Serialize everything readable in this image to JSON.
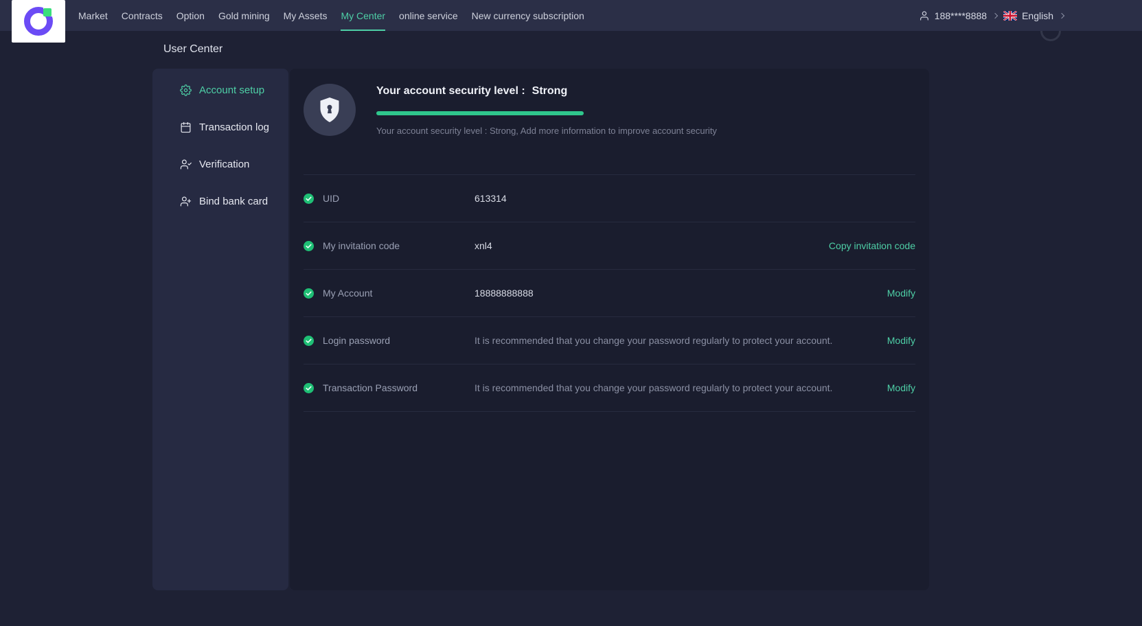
{
  "topbar": {
    "nav_items": [
      "Market",
      "Contracts",
      "Option",
      "Gold mining",
      "My Assets",
      "My Center",
      "online service",
      "New currency subscription"
    ],
    "active_item": "My Center",
    "account_label": "188****8888",
    "language_label": "English"
  },
  "page": {
    "title": "User Center"
  },
  "sidebar": {
    "items": [
      {
        "label": "Account setup",
        "icon": "gear-icon",
        "active": true
      },
      {
        "label": "Transaction log",
        "icon": "calendar-icon",
        "active": false
      },
      {
        "label": "Verification",
        "icon": "user-icon",
        "active": false
      },
      {
        "label": "Bind bank card",
        "icon": "user-icon",
        "active": false
      }
    ]
  },
  "security": {
    "title": "Your account security level :",
    "level": "Strong",
    "progress_percent": 100,
    "subtitle": "Your account security level : Strong,  Add more information to improve account security"
  },
  "rows": [
    {
      "label": "UID",
      "value": "613314",
      "action": ""
    },
    {
      "label": "My invitation code",
      "value": "xnl4",
      "action": "Copy invitation code"
    },
    {
      "label": "My Account",
      "value": "18888888888",
      "action": "Modify"
    },
    {
      "label": "Login password",
      "value": "It is recommended that you change your password regularly to protect your account.",
      "action": "Modify"
    },
    {
      "label": "Transaction Password",
      "value": "It is recommended that you change your password regularly to protect your account.",
      "action": "Modify"
    }
  ],
  "colors": {
    "accent": "#4ecfa6",
    "progress": "#2fc68c",
    "check": "#1fbf75"
  }
}
